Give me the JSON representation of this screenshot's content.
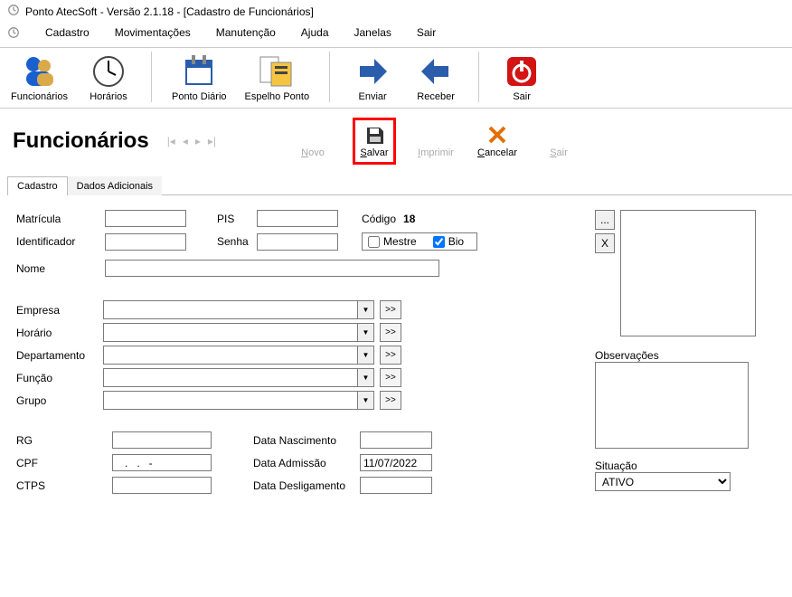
{
  "window_title": "Ponto AtecSoft - Versão 2.1.18 - [Cadastro de Funcionários]",
  "menu": [
    "Cadastro",
    "Movimentações",
    "Manutenção",
    "Ajuda",
    "Janelas",
    "Sair"
  ],
  "toolbar": {
    "funcionarios": "Funcionários",
    "horarios": "Horários",
    "ponto_diario": "Ponto Diário",
    "espelho_ponto": "Espelho Ponto",
    "enviar": "Enviar",
    "receber": "Receber",
    "sair": "Sair"
  },
  "page_title": "Funcionários",
  "actions": {
    "novo": "Novo",
    "salvar": "Salvar",
    "imprimir": "Imprimir",
    "cancelar": "Cancelar",
    "sair": "Sair"
  },
  "tabs": {
    "cadastro": "Cadastro",
    "dados_adicionais": "Dados Adicionais"
  },
  "form": {
    "matricula_label": "Matrícula",
    "matricula_value": "",
    "pis_label": "PIS",
    "pis_value": "",
    "codigo_label": "Código",
    "codigo_value": "18",
    "identificador_label": "Identificador",
    "identificador_value": "",
    "senha_label": "Senha",
    "senha_value": "",
    "mestre_label": "Mestre",
    "mestre_checked": false,
    "bio_label": "Bio",
    "bio_checked": true,
    "nome_label": "Nome",
    "nome_value": "",
    "empresa_label": "Empresa",
    "horario_label": "Horário",
    "departamento_label": "Departamento",
    "funcao_label": "Função",
    "grupo_label": "Grupo",
    "rg_label": "RG",
    "rg_value": "",
    "cpf_label": "CPF",
    "cpf_value": "   .   .   -",
    "ctps_label": "CTPS",
    "ctps_value": "",
    "data_nasc_label": "Data Nascimento",
    "data_nasc_value": "",
    "data_adm_label": "Data Admissão",
    "data_adm_value": "11/07/2022",
    "data_desl_label": "Data Desligamento",
    "data_desl_value": "",
    "obs_label": "Observações",
    "situacao_label": "Situação",
    "situacao_value": "ATIVO"
  },
  "go_glyph": ">>",
  "ellipsis": "...",
  "close_glyph": "X"
}
